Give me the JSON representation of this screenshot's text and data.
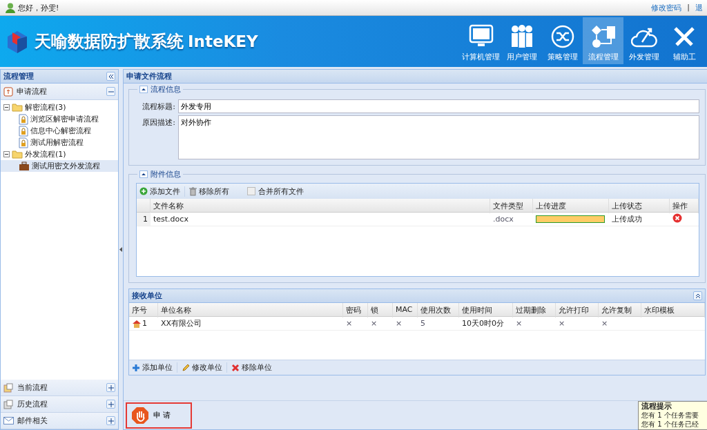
{
  "top_bar": {
    "greeting": "您好，孙雯!",
    "links": [
      "修改密码",
      "|",
      "退"
    ]
  },
  "header": {
    "title": "天喻数据防扩散系统",
    "title_suffix": "InteKEY",
    "nav": [
      {
        "label": "计算机管理",
        "selected": false
      },
      {
        "label": "用户管理",
        "selected": false
      },
      {
        "label": "策略管理",
        "selected": false
      },
      {
        "label": "流程管理",
        "selected": true
      },
      {
        "label": "外发管理",
        "selected": false
      },
      {
        "label": "辅助工",
        "selected": false
      }
    ]
  },
  "sidebar": {
    "title": "流程管理",
    "sections": [
      {
        "label": "申请流程",
        "expanded": true,
        "tree": [
          {
            "label": "解密流程(3)",
            "expanded": true,
            "selected": false,
            "children": [
              {
                "label": "浏览区解密申请流程",
                "selected": false,
                "kind": "lock"
              },
              {
                "label": "信息中心解密流程",
                "selected": false,
                "kind": "lock"
              },
              {
                "label": "测试用解密流程",
                "selected": false,
                "kind": "lock"
              }
            ]
          },
          {
            "label": "外发流程(1)",
            "expanded": true,
            "selected": false,
            "children": [
              {
                "label": "测试用密文外发流程",
                "selected": true,
                "kind": "case"
              }
            ]
          }
        ]
      },
      {
        "label": "当前流程",
        "expanded": false
      },
      {
        "label": "历史流程",
        "expanded": false
      },
      {
        "label": "邮件相关",
        "expanded": false
      }
    ]
  },
  "content": {
    "title": "申请文件流程",
    "flow_info": {
      "legend": "流程信息",
      "title_label": "流程标题:",
      "title_value": "外发专用",
      "reason_label": "原因描述:",
      "reason_value": "对外协作"
    },
    "attachments": {
      "legend": "附件信息",
      "toolbar": {
        "add": "添加文件",
        "remove_all": "移除所有",
        "merge": {
          "label": "合并所有文件",
          "checked": false
        }
      },
      "columns": [
        "文件名称",
        "文件类型",
        "上传进度",
        "上传状态",
        "操作"
      ],
      "rows": [
        {
          "index": "1",
          "name": "test.docx",
          "type": ".docx",
          "level": 1,
          "status": "上传成功"
        }
      ]
    },
    "receivers": {
      "title": "接收单位",
      "columns": [
        "序号",
        "单位名称",
        "密码",
        "锁",
        "MAC",
        "使用次数",
        "使用时间",
        "过期删除",
        "允许打印",
        "允许复制",
        "水印模板"
      ],
      "rows": [
        {
          "cells": [
            "1",
            "XX有限公司",
            "×",
            "×",
            "×",
            "5",
            "10天0时0分",
            "×",
            "×",
            "×",
            ""
          ]
        }
      ],
      "toolbar": [
        "添加单位",
        "修改单位",
        "移除单位"
      ]
    },
    "submit": "申 请"
  },
  "popup": {
    "title": "流程提示",
    "lines": [
      "您有 1 个任务需要",
      "您有 1 个任务已经"
    ]
  }
}
